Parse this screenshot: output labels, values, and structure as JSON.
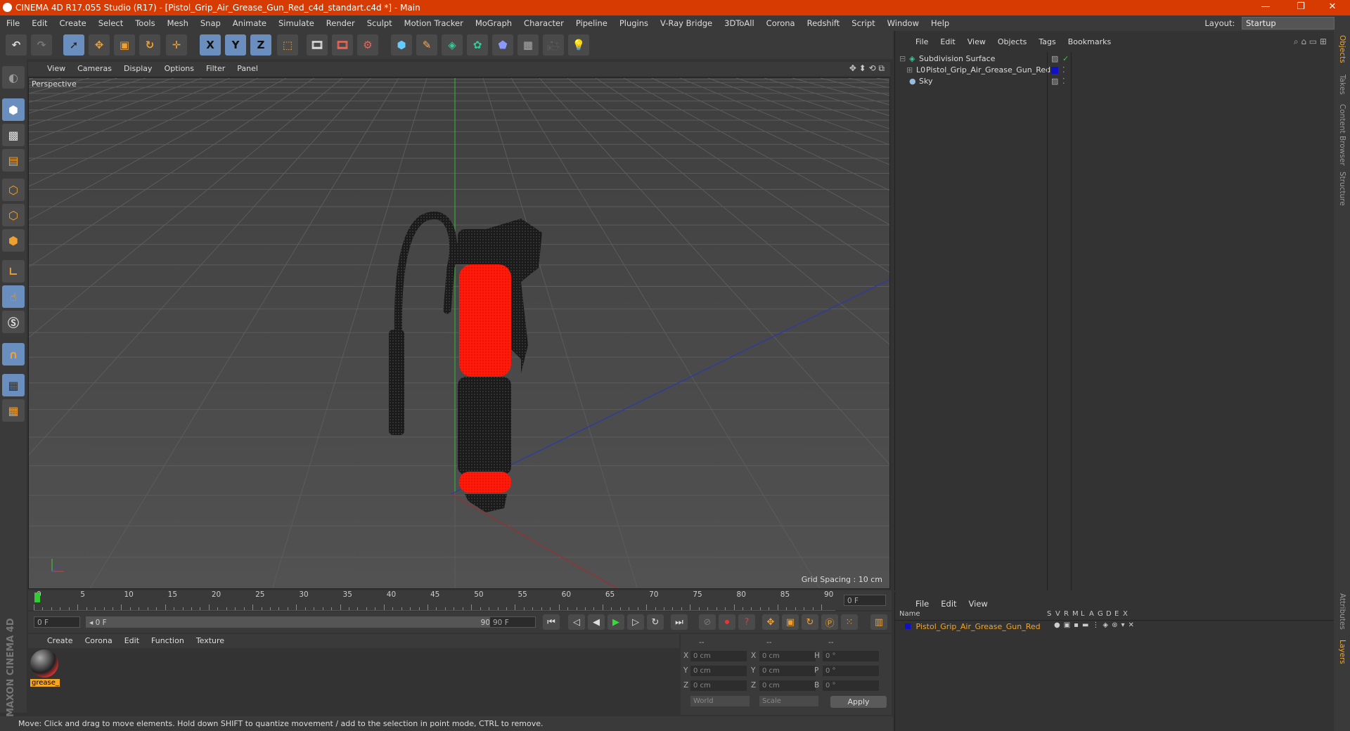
{
  "window": {
    "title": "CINEMA 4D R17.055 Studio (R17) - [Pistol_Grip_Air_Grease_Gun_Red_c4d_standart.c4d *] - Main",
    "controls": [
      "—",
      "❐",
      "✕"
    ]
  },
  "menubar": {
    "items": [
      "File",
      "Edit",
      "Create",
      "Select",
      "Tools",
      "Mesh",
      "Snap",
      "Animate",
      "Simulate",
      "Render",
      "Sculpt",
      "Motion Tracker",
      "MoGraph",
      "Character",
      "Pipeline",
      "Plugins",
      "V-Ray Bridge",
      "3DToAll",
      "Corona",
      "Redshift",
      "Script",
      "Window",
      "Help"
    ],
    "layout_label": "Layout:",
    "layout_value": "Startup"
  },
  "toolbar": {
    "axis_labels": [
      "X",
      "Y",
      "Z"
    ]
  },
  "viewport": {
    "menu": [
      "View",
      "Cameras",
      "Display",
      "Options",
      "Filter",
      "Panel"
    ],
    "label": "Perspective",
    "grid_spacing": "Grid Spacing : 10 cm"
  },
  "timeline": {
    "ticks": [
      "0",
      "5",
      "10",
      "15",
      "20",
      "25",
      "30",
      "35",
      "40",
      "45",
      "50",
      "55",
      "60",
      "65",
      "70",
      "75",
      "80",
      "85",
      "90"
    ],
    "current_frame": "0 F"
  },
  "transport": {
    "start_field": "0 F",
    "range_left": "◂ 0 F",
    "range_right": "90 F ▸",
    "end_field": "90 F"
  },
  "materials": {
    "menu": [
      "Create",
      "Corona",
      "Edit",
      "Function",
      "Texture"
    ],
    "items": [
      {
        "name": "grease_"
      }
    ]
  },
  "coordinates": {
    "header": [
      "--",
      "--",
      "--"
    ],
    "rows": [
      {
        "axis": "X",
        "pos": "0 cm",
        "size_axis": "X",
        "size": "0 cm",
        "rot_axis": "H",
        "rot": "0 °"
      },
      {
        "axis": "Y",
        "pos": "0 cm",
        "size_axis": "Y",
        "size": "0 cm",
        "rot_axis": "P",
        "rot": "0 °"
      },
      {
        "axis": "Z",
        "pos": "0 cm",
        "size_axis": "Z",
        "size": "0 cm",
        "rot_axis": "B",
        "rot": "0 °"
      }
    ],
    "mode": "World",
    "scale_mode": "Scale",
    "apply": "Apply"
  },
  "objects": {
    "menu": [
      "File",
      "Edit",
      "View",
      "Objects",
      "Tags",
      "Bookmarks"
    ],
    "rows": [
      {
        "name": "Subdivision Surface"
      },
      {
        "name": "Pistol_Grip_Air_Grease_Gun_Red"
      },
      {
        "name": "Sky"
      }
    ],
    "mesh_color": "#1010c8"
  },
  "layers": {
    "menu": [
      "File",
      "Edit",
      "View"
    ],
    "columns": [
      "Name",
      "S",
      "V",
      "R",
      "M",
      "L",
      "A",
      "G",
      "D",
      "E",
      "X"
    ],
    "row": "Pistol_Grip_Air_Grease_Gun_Red"
  },
  "side_tabs": [
    "Objects",
    "Takes",
    "Content Browser",
    "Structure",
    "Attributes",
    "Layers"
  ],
  "status": "Move: Click and drag to move elements. Hold down SHIFT to quantize movement / add to the selection in point mode, CTRL to remove.",
  "brand": "MAXON CINEMA 4D",
  "colors": {
    "titlebar": "#d83b01",
    "accent": "#f5a623",
    "red_body": "#ff1a0a"
  }
}
